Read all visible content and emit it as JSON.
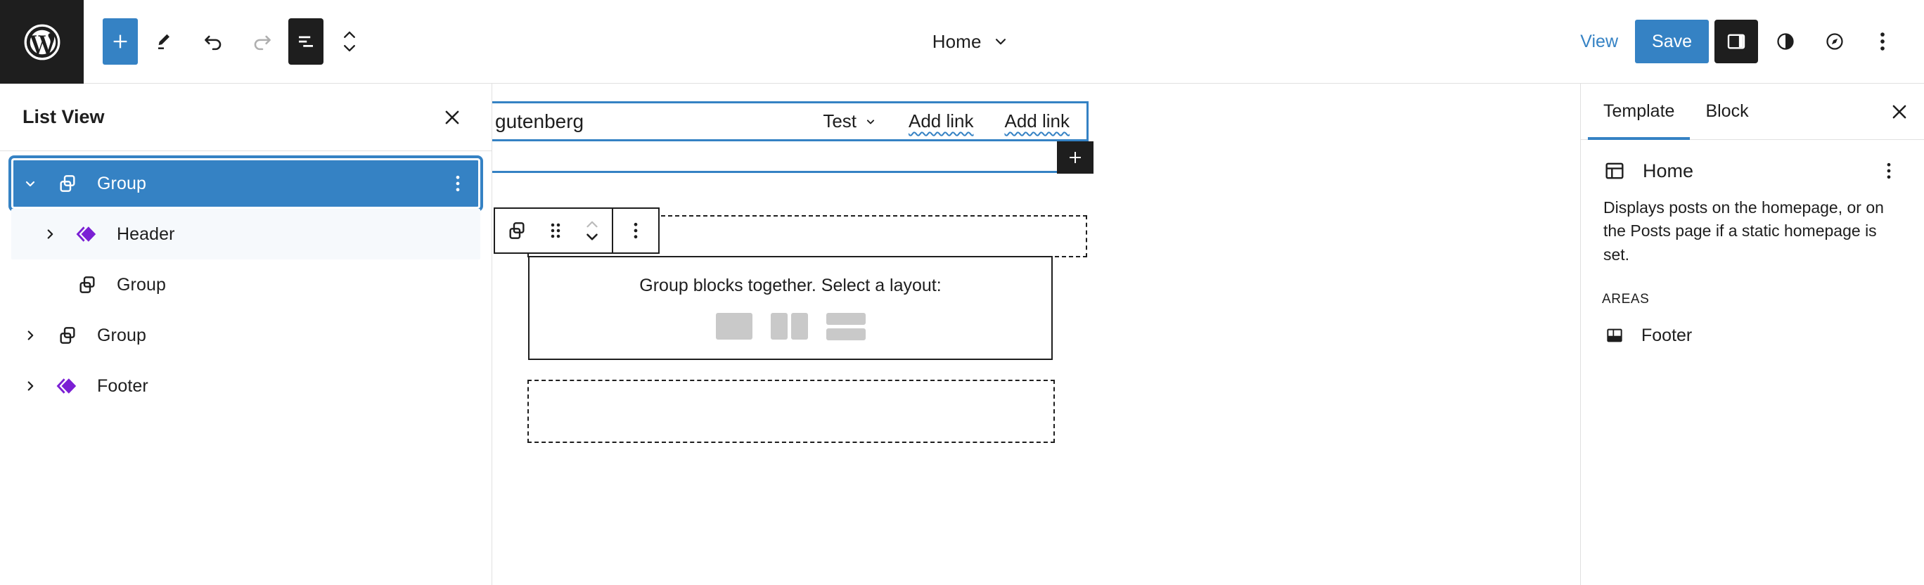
{
  "header": {
    "logo_icon": "wordpress-logo-icon",
    "tools": [
      {
        "name": "add-block-button",
        "icon": "plus-icon",
        "label": "Add block",
        "style": "primary"
      },
      {
        "name": "edit-mode-button",
        "icon": "pencil-icon",
        "label": "Edit",
        "style": "plain"
      },
      {
        "name": "undo-button",
        "icon": "undo-icon",
        "label": "Undo",
        "style": "plain"
      },
      {
        "name": "redo-button",
        "icon": "redo-icon",
        "label": "Redo",
        "style": "disabled"
      },
      {
        "name": "list-view-button",
        "icon": "list-view-icon",
        "label": "List View",
        "style": "dark"
      },
      {
        "name": "block-mover-button",
        "icon": "chevron-up-down-icon",
        "label": "Move",
        "style": "plain"
      }
    ],
    "title": "Home",
    "title_chevron_icon": "chevron-down-icon",
    "view_label": "View",
    "save_label": "Save",
    "right_icons": [
      {
        "name": "settings-sidebar-toggle",
        "icon": "sidebar-panel-icon",
        "label": "Settings",
        "active": true
      },
      {
        "name": "styles-button",
        "icon": "half-circle-contrast-icon",
        "label": "Styles",
        "active": false
      },
      {
        "name": "navigation-button",
        "icon": "compass-icon",
        "label": "Navigation",
        "active": false
      }
    ],
    "more_menu_icon": "kebab-menu-icon"
  },
  "list_view": {
    "title": "List View",
    "close_icon": "close-icon",
    "items": [
      {
        "label": "Group",
        "icon": "group-block-icon",
        "chevron": "down",
        "indent": 0,
        "selected": true,
        "subtle": false,
        "kebab": true
      },
      {
        "label": "Header",
        "icon": "template-part-icon",
        "chevron": "right",
        "indent": 1,
        "selected": false,
        "subtle": true,
        "kebab": false
      },
      {
        "label": "Group",
        "icon": "group-block-icon",
        "chevron": "none",
        "indent": 1,
        "selected": false,
        "subtle": false,
        "kebab": false
      },
      {
        "label": "Group",
        "icon": "group-block-icon",
        "chevron": "right",
        "indent": 0,
        "selected": false,
        "subtle": false,
        "kebab": false
      },
      {
        "label": "Footer",
        "icon": "template-part-icon",
        "chevron": "right",
        "indent": 0,
        "selected": false,
        "subtle": false,
        "kebab": false
      }
    ]
  },
  "canvas": {
    "site_title": "gutenberg",
    "nav_items": [
      {
        "label": "Test",
        "style": "dropdown",
        "chevron_icon": "chevron-down-icon"
      },
      {
        "label": "Add link",
        "style": "placeholder"
      },
      {
        "label": "Add link",
        "style": "placeholder"
      }
    ],
    "appender_icon": "plus-icon",
    "block_toolbar": [
      {
        "name": "block-type-button",
        "icon": "group-block-icon",
        "label": "Group"
      },
      {
        "name": "drag-handle",
        "icon": "drag-dots-icon",
        "label": "Drag"
      },
      {
        "name": "move-up-button",
        "icon": "chevron-up-icon",
        "label": "Move up",
        "disabled": true
      },
      {
        "name": "move-down-button",
        "icon": "chevron-down-icon",
        "label": "Move down",
        "disabled": false
      },
      {
        "name": "block-options-button",
        "icon": "kebab-menu-icon",
        "label": "Options"
      }
    ],
    "group_placeholder": {
      "prompt": "Group blocks together. Select a layout:",
      "variations": [
        {
          "name": "group-variation-group",
          "label": "Group"
        },
        {
          "name": "group-variation-row",
          "label": "Row"
        },
        {
          "name": "group-variation-stack",
          "label": "Stack"
        }
      ]
    }
  },
  "sidebar": {
    "tabs": [
      {
        "label": "Template",
        "active": true
      },
      {
        "label": "Block",
        "active": false
      }
    ],
    "close_icon": "close-icon",
    "template": {
      "icon": "template-layout-icon",
      "title": "Home",
      "kebab_icon": "kebab-menu-icon",
      "description": "Displays posts on the homepage, or on the Posts page if a static homepage is set."
    },
    "areas_label": "AREAS",
    "areas": [
      {
        "label": "Footer",
        "icon": "footer-area-icon"
      }
    ]
  },
  "colors": {
    "accent": "#3582c4",
    "dark": "#1e1e1e",
    "template_part": "#7b1fd4",
    "placeholder_gray": "#c9c9c9",
    "border": "#e0e0e0"
  }
}
